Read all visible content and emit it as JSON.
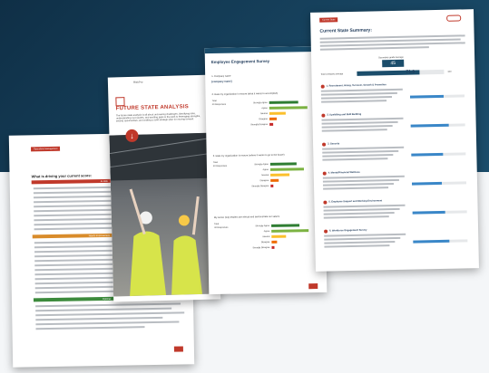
{
  "p1": {
    "tag": "Operations Management",
    "question": "What is driving your current score:",
    "sections": [
      "At Risk",
      "Needs Improvement",
      "Optimal"
    ],
    "footer": "",
    "colors": {
      "high": "#c0392b",
      "mid": "#d98c2b",
      "ok": "#3c8a3c"
    }
  },
  "p2": {
    "logo": "RiskPro",
    "title": "FUTURE STATE ANALYSIS",
    "subtitle": "The future state analysis is all about uncovering challenges, identifying risks, understanding root causes, and spotting gaps in the path to leveraging strengths, seizing opportunities, and crafting a solid strategic plan for moving forward.",
    "arrow": "down-arrow-icon",
    "footer": ""
  },
  "p3": {
    "title": "Employee Engagement Survey",
    "company_label": "1. Company name",
    "company_value": "[company name]",
    "q1": "2. Rate my organization is ensure (what it wants to accomplish)",
    "q2": "3. Rate my organization is ensure (where it wants to go to the future)",
    "q3": "My senior (top) leaders are ethical and demonstrate our values.",
    "resp_label": "Total",
    "resp_count": "40 Responses",
    "scale": [
      "Strongly Agree",
      "Agree",
      "Neutral",
      "Disagree",
      "Strongly Disagree"
    ],
    "q1_values": [
      0.62,
      0.8,
      0.35,
      0.15,
      0.08
    ],
    "q2_values": [
      0.55,
      0.72,
      0.4,
      0.18,
      0.06
    ],
    "q3_values": [
      0.6,
      0.78,
      0.3,
      0.12,
      0.05
    ],
    "bar_colors": [
      "#2e7d32",
      "#7cb342",
      "#fbc02d",
      "#ef6c00",
      "#c62828"
    ],
    "footer": ""
  },
  "p4": {
    "tag": "Current State",
    "title": "Current State Summary:",
    "score_label": "Secondary grade Average",
    "score_value": "45",
    "total_label": "Total company average",
    "total_value": "71.9",
    "total_max": "100",
    "items": [
      {
        "title": "1. Recruitment, Hiring, Turnover, Growth & Promotion",
        "value": 0.62
      },
      {
        "title": "2. Upskilling and Skill Building",
        "value": 0.7
      },
      {
        "title": "3. Security",
        "value": 0.58
      },
      {
        "title": "4. Mental/Financial Wellness",
        "value": 0.55
      },
      {
        "title": "5. Employee Support and Working Environment",
        "value": 0.6
      },
      {
        "title": "6. Workforce Engagement Survey",
        "value": 0.66
      }
    ],
    "footer": ""
  }
}
